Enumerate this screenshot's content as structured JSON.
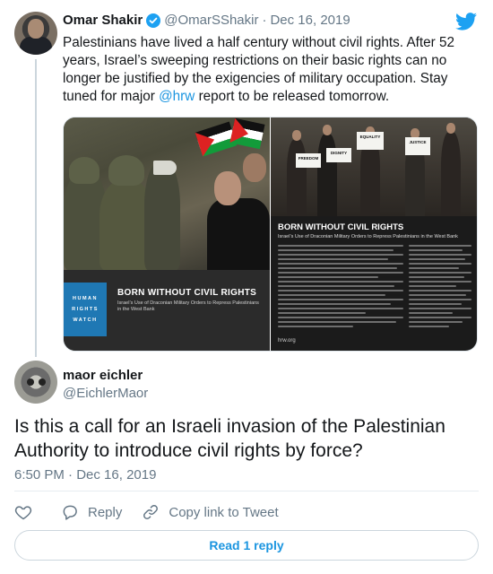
{
  "parent_tweet": {
    "author_name": "Omar Shakir",
    "author_handle": "@OmarSShakir",
    "separator": "·",
    "date": "Dec 16, 2019",
    "text_before_mention": "Palestinians have lived a half century without civil rights. After 52 years, Israel’s sweeping restrictions on their basic rights can no longer be justified by the exigencies of military occupation. Stay tuned for major ",
    "mention": "@hrw",
    "text_after_mention": " report to be released tomorrow.",
    "media": {
      "left_image": {
        "logo_text": "HUMAN RIGHTS WATCH",
        "title": "BORN WITHOUT CIVIL RIGHTS",
        "subtitle": "Israel’s Use of Draconian Military Orders to Repress Palestinians in the West Bank"
      },
      "right_image": {
        "signs": [
          "FREEDOM",
          "DIGNITY",
          "EQUALITY",
          "JUSTICE"
        ],
        "title": "BORN WITHOUT CIVIL RIGHTS",
        "subtitle": "Israel’s Use of Draconian Military Orders to Repress Palestinians in the West Bank",
        "url": "hrw.org"
      }
    }
  },
  "reply_tweet": {
    "author_name": "maor eichler",
    "author_handle": "@EichlerMaor",
    "text": "Is this a call for an Israeli invasion of the Palestinian Authority to introduce civil rights by force?",
    "time": "6:50 PM",
    "separator": "·",
    "date": "Dec 16, 2019"
  },
  "actions": {
    "like_icon": "heart-icon",
    "reply_label": "Reply",
    "reply_icon": "speech-bubble-icon",
    "copy_link_label": "Copy link to Tweet",
    "copy_link_icon": "link-icon"
  },
  "read_replies": {
    "label": "Read 1 reply"
  },
  "colors": {
    "accent": "#1b95e0",
    "secondary_text": "#657786",
    "divider": "#e6ecf0"
  }
}
